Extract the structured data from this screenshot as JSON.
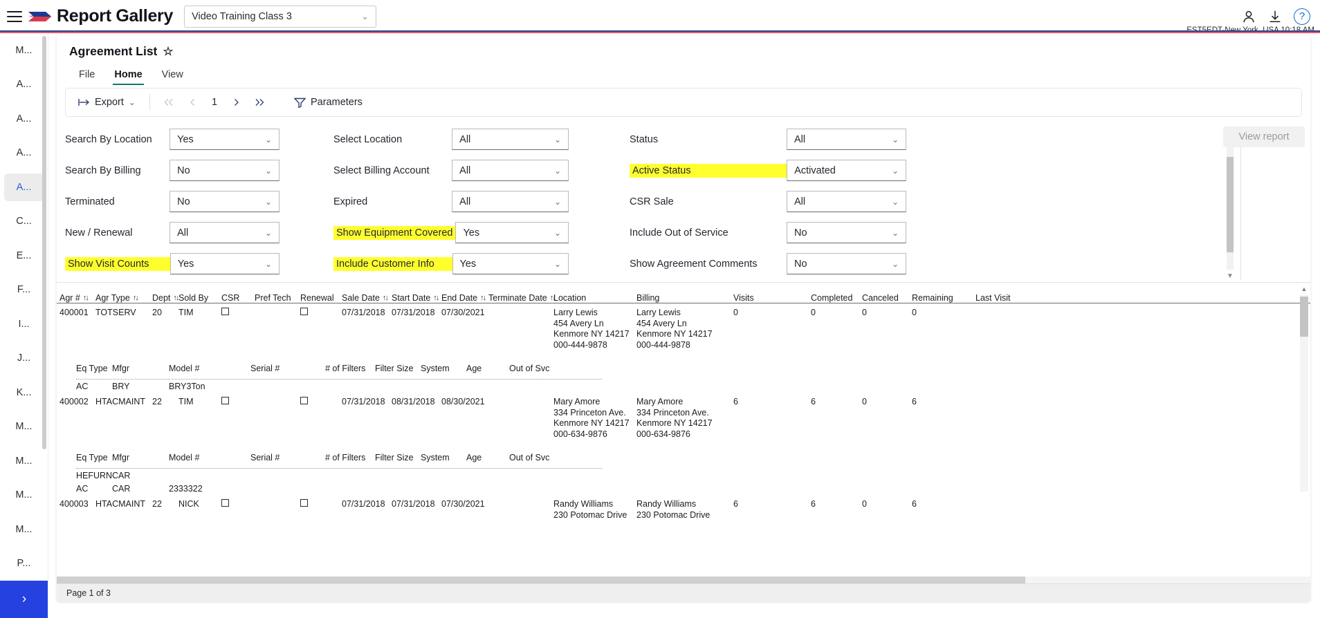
{
  "topbar": {
    "brand": "Report Gallery",
    "class_selector_value": "Video Training Class 3",
    "menu_icon": "hamburger-icon",
    "timezone": "EST5EDT-New York, USA 10:18 AM",
    "help_label": "?"
  },
  "sidebar": {
    "items": [
      {
        "label": "M...",
        "active": false
      },
      {
        "label": "A...",
        "active": false
      },
      {
        "label": "A...",
        "active": false
      },
      {
        "label": "A...",
        "active": false
      },
      {
        "label": "A...",
        "active": true
      },
      {
        "label": "C...",
        "active": false
      },
      {
        "label": "E...",
        "active": false
      },
      {
        "label": "F...",
        "active": false
      },
      {
        "label": "I...",
        "active": false
      },
      {
        "label": "J...",
        "active": false
      },
      {
        "label": "K...",
        "active": false
      },
      {
        "label": "M...",
        "active": false
      },
      {
        "label": "M...",
        "active": false
      },
      {
        "label": "M...",
        "active": false
      },
      {
        "label": "M...",
        "active": false
      },
      {
        "label": "P...",
        "active": false
      }
    ],
    "expand_label": "›"
  },
  "report": {
    "title": "Agreement List",
    "star": "☆",
    "tabs": [
      {
        "label": "File",
        "active": false
      },
      {
        "label": "Home",
        "active": true
      },
      {
        "label": "View",
        "active": false
      }
    ],
    "toolbar": {
      "export_label": "Export",
      "export_chevron": "∨",
      "first_page": "⏪",
      "prev_page": "◁",
      "page_number": "1",
      "next_page": "▷",
      "last_page": "⏩",
      "parameters_label": "Parameters"
    }
  },
  "parameters": {
    "view_report_label": "View report",
    "column1": [
      {
        "label": "Search By Location",
        "value": "Yes",
        "highlight": false
      },
      {
        "label": "Search By Billing",
        "value": "No",
        "highlight": false
      },
      {
        "label": "Terminated",
        "value": "No",
        "highlight": false
      },
      {
        "label": "New / Renewal",
        "value": "All",
        "highlight": false
      },
      {
        "label": "Show Visit Counts",
        "value": "Yes",
        "highlight": true
      }
    ],
    "column2": [
      {
        "label": "Select Location",
        "value": "All",
        "highlight": false
      },
      {
        "label": "Select Billing Account",
        "value": "All",
        "highlight": false
      },
      {
        "label": "Expired",
        "value": "All",
        "highlight": false
      },
      {
        "label": "Show Equipment Covered",
        "value": "Yes",
        "highlight": true
      },
      {
        "label": "Include Customer Info",
        "value": "Yes",
        "highlight": true
      }
    ],
    "column3": [
      {
        "label": "Status",
        "value": "All",
        "highlight": false
      },
      {
        "label": "Active Status",
        "value": "Activated",
        "highlight": true
      },
      {
        "label": "CSR Sale",
        "value": "All",
        "highlight": false
      },
      {
        "label": "Include Out of Service",
        "value": "No",
        "highlight": false
      },
      {
        "label": "Show Agreement Comments",
        "value": "No",
        "highlight": false
      }
    ]
  },
  "table": {
    "headers": [
      {
        "label": "Agr #",
        "sortable": true
      },
      {
        "label": "Agr Type",
        "sortable": true
      },
      {
        "label": "Dept",
        "sortable": true
      },
      {
        "label": "Sold By",
        "sortable": false
      },
      {
        "label": "CSR",
        "sortable": false
      },
      {
        "label": "Pref Tech",
        "sortable": false
      },
      {
        "label": "Renewal",
        "sortable": false
      },
      {
        "label": "Sale Date",
        "sortable": true
      },
      {
        "label": "Start Date",
        "sortable": true
      },
      {
        "label": "End Date",
        "sortable": true
      },
      {
        "label": "Terminate Date",
        "sortable": true
      },
      {
        "label": "Location",
        "sortable": false
      },
      {
        "label": "Billing",
        "sortable": false
      },
      {
        "label": "Visits",
        "sortable": false
      },
      {
        "label": "Completed",
        "sortable": false
      },
      {
        "label": "Canceled",
        "sortable": false
      },
      {
        "label": "Remaining",
        "sortable": false
      },
      {
        "label": "Last Visit",
        "sortable": false
      }
    ],
    "equipment_headers": [
      "Eq Type",
      "Mfgr",
      "Model #",
      "Serial #",
      "# of Filters",
      "Filter Size",
      "System",
      "Age",
      "Out of Svc"
    ],
    "rows": [
      {
        "agr": "400001",
        "type": "TOTSERV",
        "dept": "20",
        "sold_by": "TIM",
        "sale_date": "07/31/2018",
        "start_date": "07/31/2018",
        "end_date": "07/30/2021",
        "terminate_date": "",
        "location": [
          "Larry Lewis",
          "454 Avery Ln",
          "Kenmore NY 14217",
          "000-444-9878"
        ],
        "billing": [
          "Larry Lewis",
          "454 Avery Ln",
          "Kenmore NY 14217",
          "000-444-9878"
        ],
        "visits": "0",
        "completed": "0",
        "canceled": "0",
        "remaining": "0",
        "last_visit": "",
        "equipment": [
          {
            "eq_type": "AC",
            "mfgr": "BRY",
            "model": "BRY3Ton",
            "serial": "",
            "filters": "",
            "filter_size": "",
            "system": "",
            "age": "",
            "out_of_svc": ""
          }
        ]
      },
      {
        "agr": "400002",
        "type": "HTACMAINT",
        "dept": "22",
        "sold_by": "TIM",
        "sale_date": "07/31/2018",
        "start_date": "08/31/2018",
        "end_date": "08/30/2021",
        "terminate_date": "",
        "location": [
          "Mary Amore",
          "334 Princeton Ave.",
          "Kenmore NY 14217",
          "000-634-9876"
        ],
        "billing": [
          "Mary Amore",
          "334 Princeton Ave.",
          "Kenmore NY 14217",
          "000-634-9876"
        ],
        "visits": "6",
        "completed": "6",
        "canceled": "0",
        "remaining": "6",
        "last_visit": "",
        "equipment": [
          {
            "eq_type": "HEFURN",
            "mfgr": "CAR",
            "model": "",
            "serial": "",
            "filters": "",
            "filter_size": "",
            "system": "",
            "age": "",
            "out_of_svc": ""
          },
          {
            "eq_type": "AC",
            "mfgr": "CAR",
            "model": "2333322",
            "serial": "",
            "filters": "",
            "filter_size": "",
            "system": "",
            "age": "",
            "out_of_svc": ""
          }
        ]
      },
      {
        "agr": "400003",
        "type": "HTACMAINT",
        "dept": "22",
        "sold_by": "NICK",
        "sale_date": "07/31/2018",
        "start_date": "07/31/2018",
        "end_date": "07/30/2021",
        "terminate_date": "",
        "location": [
          "Randy Williams",
          "230 Potomac Drive"
        ],
        "billing": [
          "Randy Williams",
          "230 Potomac Drive"
        ],
        "visits": "6",
        "completed": "6",
        "canceled": "0",
        "remaining": "6",
        "last_visit": "",
        "equipment": []
      }
    ],
    "footer": "Page 1 of 3"
  }
}
